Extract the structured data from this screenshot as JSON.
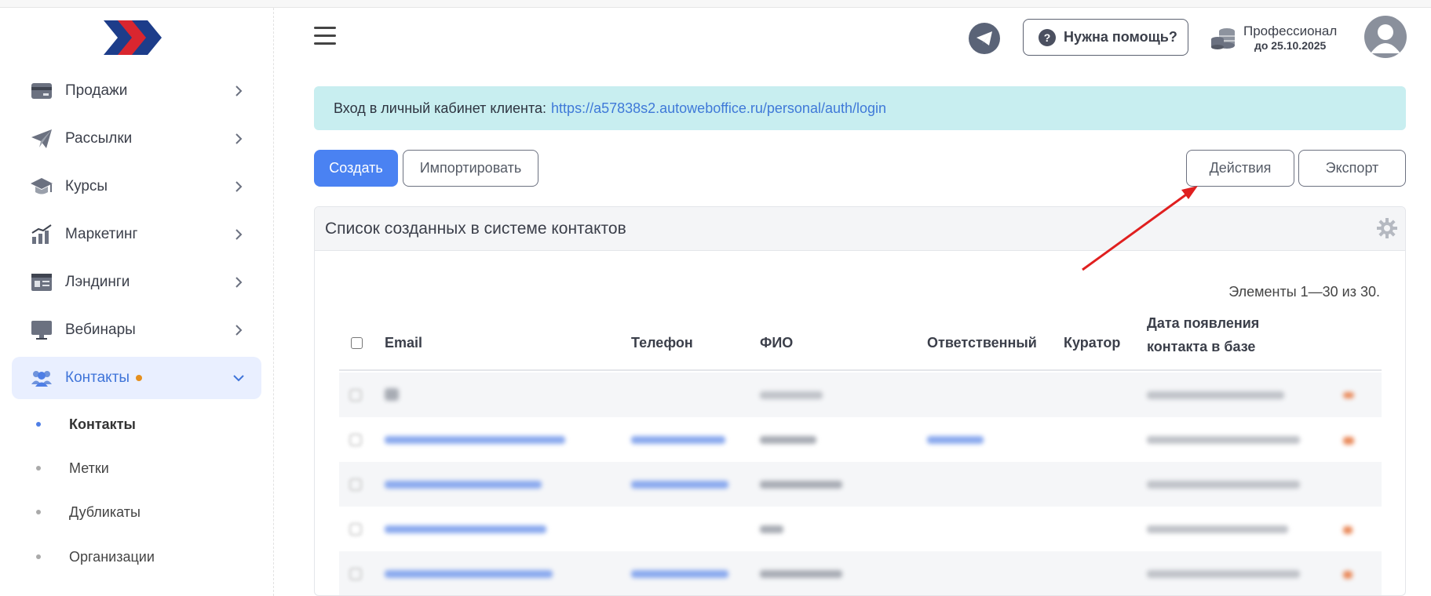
{
  "sidebar": {
    "items": [
      {
        "label": "Продажи",
        "icon": "card-icon"
      },
      {
        "label": "Рассылки",
        "icon": "paper-plane-icon"
      },
      {
        "label": "Курсы",
        "icon": "graduation-cap-icon"
      },
      {
        "label": "Маркетинг",
        "icon": "chart-growth-icon"
      },
      {
        "label": "Лэндинги",
        "icon": "landing-page-icon"
      },
      {
        "label": "Вебинары",
        "icon": "monitor-icon"
      },
      {
        "label": "Контакты",
        "icon": "users-icon"
      }
    ],
    "subitems": [
      {
        "label": "Контакты"
      },
      {
        "label": "Метки"
      },
      {
        "label": "Дубликаты"
      },
      {
        "label": "Организации"
      }
    ]
  },
  "header": {
    "help_label": "Нужна помощь?",
    "plan_name": "Профессионал",
    "plan_until": "до 25.10.2025"
  },
  "info": {
    "text": "Вход в личный кабинет клиента:",
    "link": "https://a57838s2.autoweboffice.ru/personal/auth/login"
  },
  "toolbar": {
    "create_label": "Создать",
    "import_label": "Импортировать",
    "actions_label": "Действия",
    "export_label": "Экспорт"
  },
  "card": {
    "title": "Список созданных в системе контактов",
    "count_text": "Элементы 1—30 из 30."
  },
  "table": {
    "headers": {
      "email": "Email",
      "phone": "Телефон",
      "name": "ФИО",
      "responsible": "Ответственный",
      "curator": "Куратор",
      "date_line1": "Дата появления",
      "date_line2": "контакта в базе"
    }
  },
  "colors": {
    "accent": "#4a82f2",
    "info_bg": "#c8eef0",
    "link": "#3f79d8",
    "arrow": "#e01f1f",
    "active_nav_bg": "#e9efff",
    "badge_dot": "#e58f1e"
  }
}
